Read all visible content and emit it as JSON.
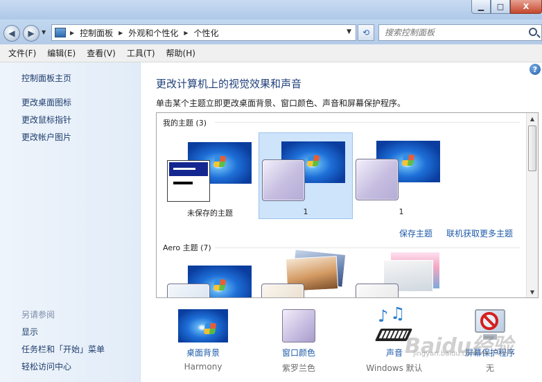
{
  "window": {
    "minimize": "▁",
    "maximize": "□",
    "close": "X"
  },
  "address": {
    "icon": "control-panel-icon",
    "crumbs": [
      "控制面板",
      "外观和个性化",
      "个性化"
    ],
    "search_placeholder": "搜索控制面板"
  },
  "menu": [
    "文件(F)",
    "编辑(E)",
    "查看(V)",
    "工具(T)",
    "帮助(H)"
  ],
  "sidebar": {
    "links": [
      "控制面板主页",
      "更改桌面图标",
      "更改鼠标指针",
      "更改帐户图片"
    ],
    "see_also_heading": "另请参阅",
    "see_also": [
      "显示",
      "任务栏和「开始」菜单",
      "轻松访问中心"
    ]
  },
  "main": {
    "title": "更改计算机上的视觉效果和声音",
    "description": "单击某个主题立即更改桌面背景、窗口颜色、声音和屏幕保护程序。",
    "my_themes_label": "我的主题 (3)",
    "my_themes": [
      {
        "name": "未保存的主题",
        "selected": false
      },
      {
        "name": "1",
        "selected": true
      },
      {
        "name": "1",
        "selected": false
      }
    ],
    "save_theme": "保存主题",
    "get_more": "联机获取更多主题",
    "aero_label": "Aero 主题 (7)"
  },
  "tray": [
    {
      "label": "桌面背景",
      "sub": "Harmony",
      "icon": "desktop-background-icon"
    },
    {
      "label": "窗口颜色",
      "sub": "紫罗兰色",
      "icon": "window-color-icon"
    },
    {
      "label": "声音",
      "sub": "Windows 默认",
      "icon": "sound-icon"
    },
    {
      "label": "屏幕保护程序",
      "sub": "无",
      "icon": "screensaver-icon"
    }
  ],
  "watermark": {
    "text": "Baidu经验",
    "sub": "jingyan.baidu.com"
  }
}
